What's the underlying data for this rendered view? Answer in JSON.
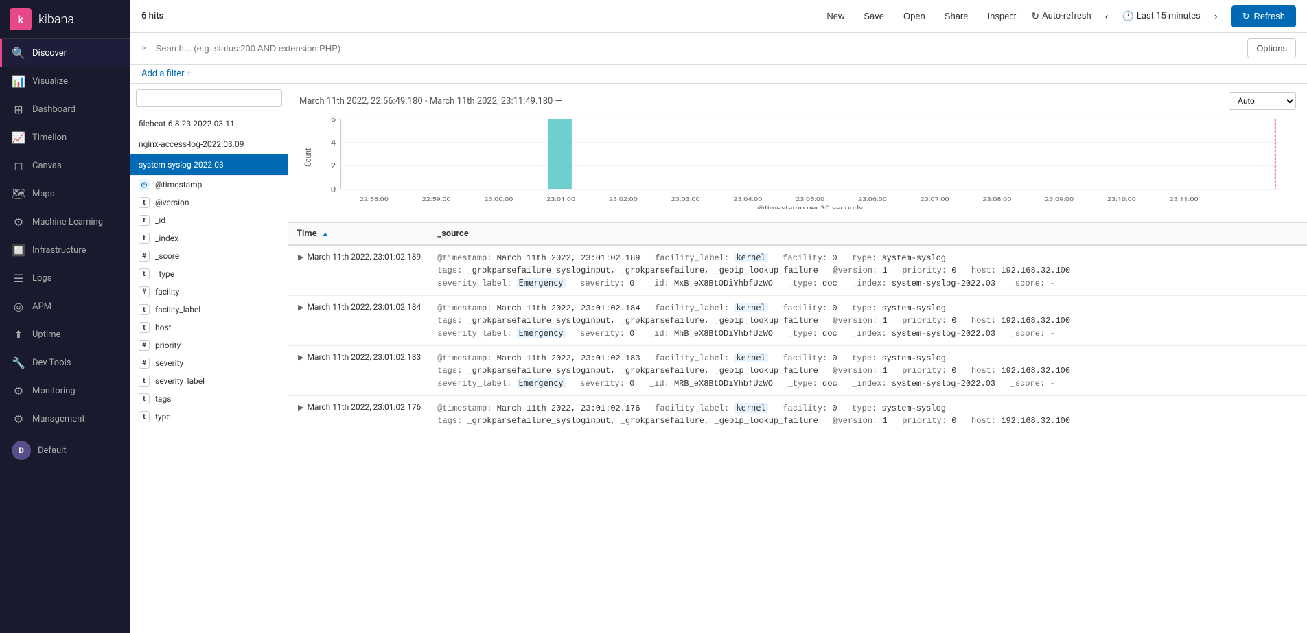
{
  "app": {
    "title": "kibana",
    "logo_letter": "k"
  },
  "topbar": {
    "hits": "6 hits",
    "actions": [
      "New",
      "Save",
      "Open",
      "Share",
      "Inspect"
    ],
    "auto_refresh_label": "Auto-refresh",
    "time_range": "Last 15 minutes",
    "refresh_label": "Refresh",
    "options_label": "Options"
  },
  "search": {
    "placeholder": "Search... (e.g. status:200 AND extension:PHP)"
  },
  "filter": {
    "add_label": "Add a filter +"
  },
  "chart": {
    "time_range": "March 11th 2022, 22:56:49.180 - March 11th 2022, 23:11:49.180 —",
    "auto_label": "Auto",
    "y_axis_label": "Count",
    "x_axis_label": "@timestamp per 30 seconds",
    "x_ticks": [
      "22:58:00",
      "22:59:00",
      "23:00:00",
      "23:01:00",
      "23:02:00",
      "23:03:00",
      "23:04:00",
      "23:05:00",
      "23:06:00",
      "23:07:00",
      "23:08:00",
      "23:09:00",
      "23:10:00",
      "23:11:00"
    ],
    "y_ticks": [
      "0",
      "2",
      "4",
      "6"
    ],
    "bar_data": [
      {
        "x": "23:01:00",
        "height": 6,
        "color": "#6fcfcf"
      }
    ]
  },
  "left_panel": {
    "search_placeholder": "",
    "indexes": [
      {
        "label": "filebeat-6.8.23-2022.03.11",
        "selected": false
      },
      {
        "label": "nginx-access-log-2022.03.09",
        "selected": false
      },
      {
        "label": "system-syslog-2022.03",
        "selected": true
      }
    ],
    "fields": [
      {
        "type": "date",
        "type_char": "◷",
        "name": "@timestamp"
      },
      {
        "type": "text",
        "type_char": "t",
        "name": "@version"
      },
      {
        "type": "text",
        "type_char": "t",
        "name": "_id"
      },
      {
        "type": "text",
        "type_char": "t",
        "name": "_index"
      },
      {
        "type": "number",
        "type_char": "#",
        "name": "_score"
      },
      {
        "type": "text",
        "type_char": "t",
        "name": "_type"
      },
      {
        "type": "number",
        "type_char": "#",
        "name": "facility"
      },
      {
        "type": "text",
        "type_char": "t",
        "name": "facility_label"
      },
      {
        "type": "text",
        "type_char": "t",
        "name": "host"
      },
      {
        "type": "number",
        "type_char": "#",
        "name": "priority"
      },
      {
        "type": "number",
        "type_char": "#",
        "name": "severity"
      },
      {
        "type": "text",
        "type_char": "t",
        "name": "severity_label"
      },
      {
        "type": "text",
        "type_char": "t",
        "name": "tags"
      },
      {
        "type": "text",
        "type_char": "t",
        "name": "type"
      }
    ]
  },
  "sidebar": {
    "items": [
      {
        "label": "Discover",
        "active": true,
        "icon": "🔍"
      },
      {
        "label": "Visualize",
        "active": false,
        "icon": "📊"
      },
      {
        "label": "Dashboard",
        "active": false,
        "icon": "⊞"
      },
      {
        "label": "Timelion",
        "active": false,
        "icon": "📈"
      },
      {
        "label": "Canvas",
        "active": false,
        "icon": "◻"
      },
      {
        "label": "Maps",
        "active": false,
        "icon": "🗺"
      },
      {
        "label": "Machine Learning",
        "active": false,
        "icon": "⚙"
      },
      {
        "label": "Infrastructure",
        "active": false,
        "icon": "🔲"
      },
      {
        "label": "Logs",
        "active": false,
        "icon": "☰"
      },
      {
        "label": "APM",
        "active": false,
        "icon": "◎"
      },
      {
        "label": "Uptime",
        "active": false,
        "icon": "⬆"
      },
      {
        "label": "Dev Tools",
        "active": false,
        "icon": "🔧"
      },
      {
        "label": "Monitoring",
        "active": false,
        "icon": "⚙"
      },
      {
        "label": "Management",
        "active": false,
        "icon": "⚙"
      },
      {
        "label": "Default",
        "active": false,
        "icon": "D",
        "is_avatar": true
      }
    ]
  },
  "results": {
    "columns": [
      "Time",
      "_source"
    ],
    "rows": [
      {
        "time": "March 11th 2022, 23:01:02.189",
        "source": "@timestamp: March 11th 2022, 23:01:02.189  facility_label: kernel  facility: 0  type: system-syslog\ntags: _grokparsefailure_sysloginput, _grokparsefailure, _geoip_lookup_failure  @version: 1  priority: 0  host: 192.168.32.100\nseverity_label: Emergency  severity: 0  _id: MxB_eX8BtODiYhbfUzWO  _type: doc  _index: system-syslog-2022.03  _score: -"
      },
      {
        "time": "March 11th 2022, 23:01:02.184",
        "source": "@timestamp: March 11th 2022, 23:01:02.184  facility_label: kernel  facility: 0  type: system-syslog\ntags: _grokparsefailure_sysloginput, _grokparsefailure, _geoip_lookup_failure  @version: 1  priority: 0  host: 192.168.32.100\nseverity_label: Emergency  severity: 0  _id: MhB_eX8BtODiYhbfUzWO  _type: doc  _index: system-syslog-2022.03  _score: -"
      },
      {
        "time": "March 11th 2022, 23:01:02.183",
        "source": "@timestamp: March 11th 2022, 23:01:02.183  facility_label: kernel  facility: 0  type: system-syslog\ntags: _grokparsefailure_sysloginput, _grokparsefailure, _geoip_lookup_failure  @version: 1  priority: 0  host: 192.168.32.100\nseverity_label: Emergency  severity: 0  _id: MRB_eX8BtODiYhbfUzWO  _type: doc  _index: system-syslog-2022.03  _score: -"
      },
      {
        "time": "March 11th 2022, 23:01:02.176",
        "source": "@timestamp: March 11th 2022, 23:01:02.176  facility_label: kernel  facility: 0  type: system-syslog\ntags: _grokparsefailure_sysloginput, _grokparsefailure, _geoip_lookup_failure  @version: 1  priority: 0  host: 192.168.32.100"
      }
    ]
  }
}
